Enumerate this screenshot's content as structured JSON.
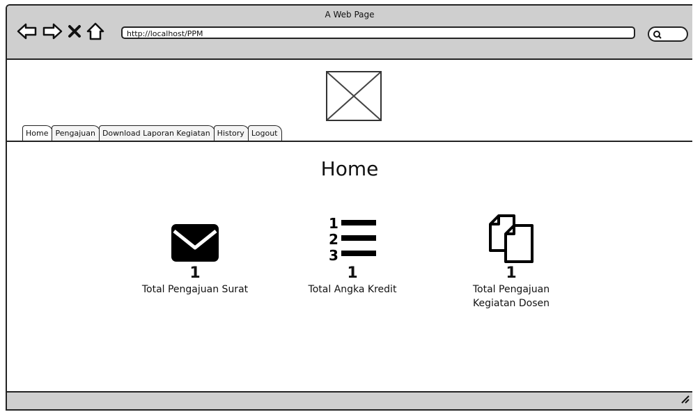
{
  "window": {
    "title": "A Web Page"
  },
  "browser": {
    "url": "http://localhost/PPM"
  },
  "icons": {
    "back": "back-arrow-icon",
    "forward": "forward-arrow-icon",
    "stop": "close-icon",
    "home": "home-icon",
    "search": "search-icon",
    "logo": "image-placeholder-icon",
    "envelope": "envelope-icon",
    "list": "numbered-list-icon",
    "documents": "documents-icon"
  },
  "nav": {
    "tabs": [
      {
        "label": "Home"
      },
      {
        "label": "Pengajuan"
      },
      {
        "label": "Download Laporan Kegiatan"
      },
      {
        "label": "History"
      },
      {
        "label": "Logout"
      }
    ]
  },
  "page": {
    "title": "Home"
  },
  "stats": [
    {
      "count": "1",
      "label": "Total Pengajuan Surat"
    },
    {
      "count": "1",
      "label": "Total Angka Kredit"
    },
    {
      "count": "1",
      "label": "Total Pengajuan\nKegiatan Dosen"
    }
  ]
}
